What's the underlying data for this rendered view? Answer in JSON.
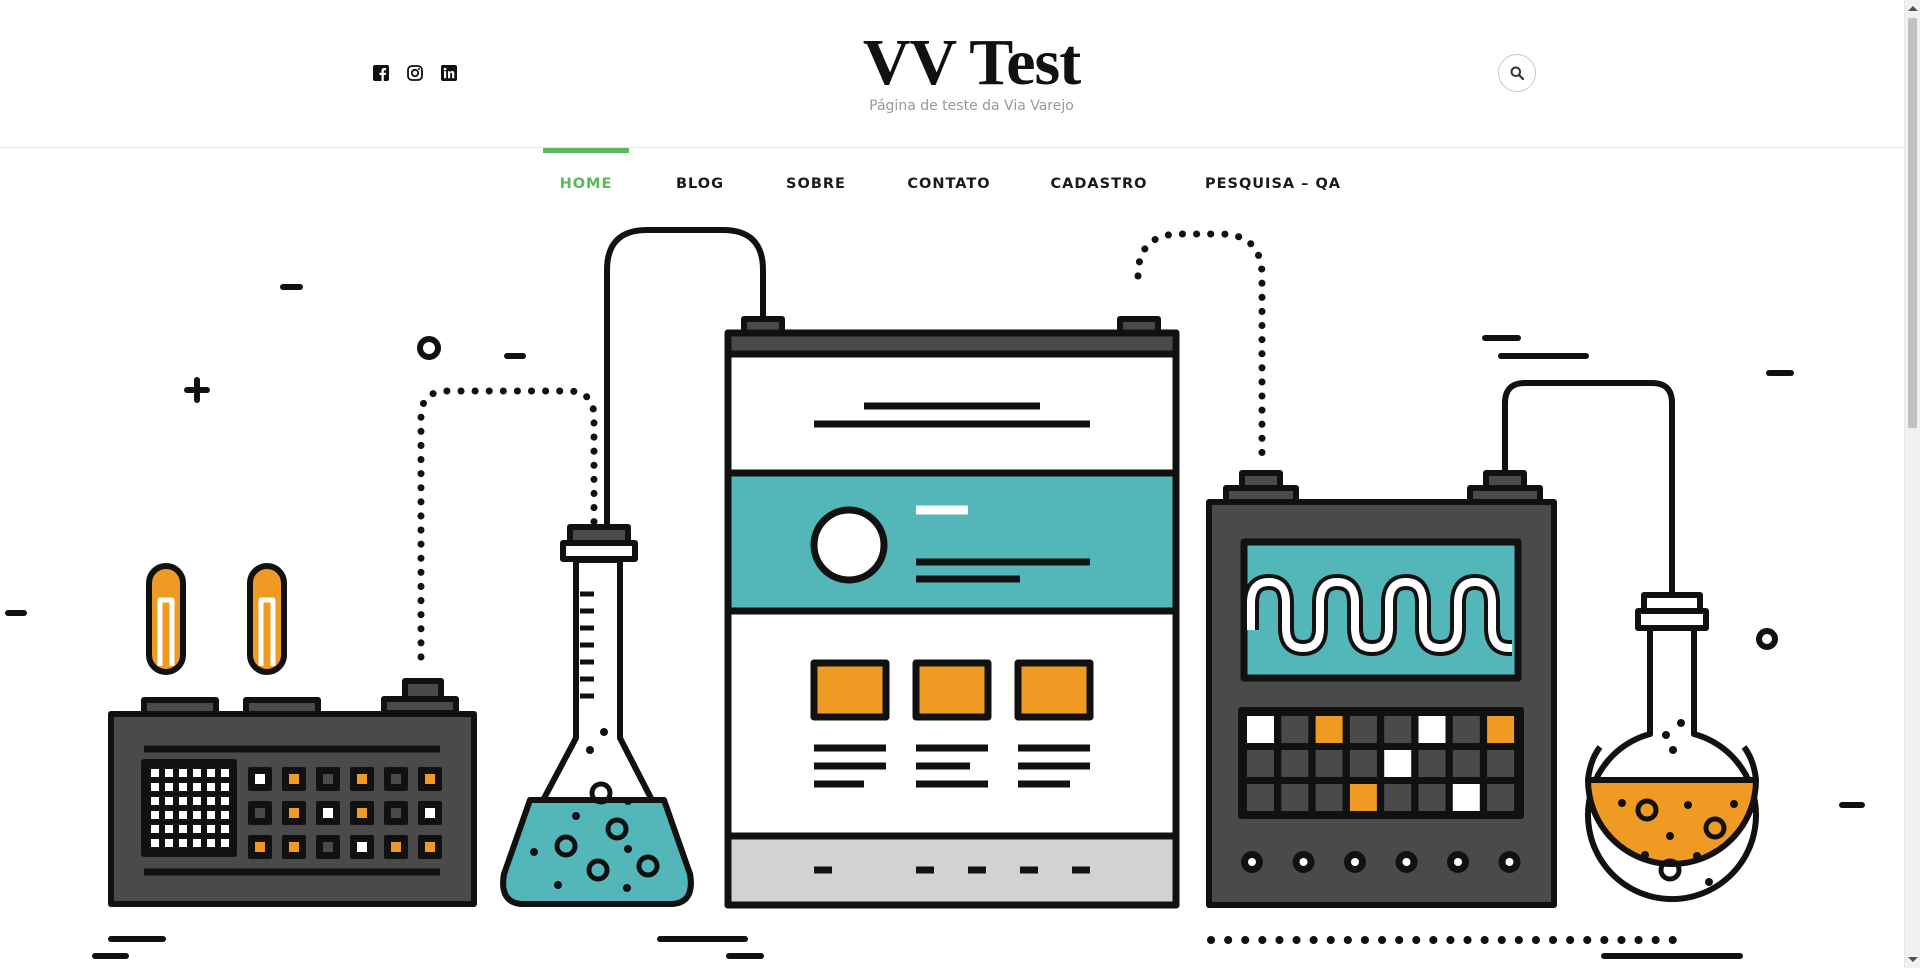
{
  "site": {
    "title": "VV Test",
    "description": "Página de teste da Via Varejo"
  },
  "social": [
    {
      "icon": "facebook-icon"
    },
    {
      "icon": "instagram-icon"
    },
    {
      "icon": "linkedin-icon"
    }
  ],
  "search": {
    "icon": "search-icon"
  },
  "nav": {
    "items": [
      {
        "label": "HOME",
        "active": true
      },
      {
        "label": "BLOG"
      },
      {
        "label": "SOBRE"
      },
      {
        "label": "CONTATO"
      },
      {
        "label": "CADASTRO"
      },
      {
        "label": "PESQUISA – QA"
      }
    ]
  },
  "hero": {
    "illustration": "laboratory-equipment-illustration"
  },
  "colors": {
    "accent": "#5cb85c",
    "teal": "#53b6b9",
    "orange": "#ef9a23",
    "dark": "#4a4a4a",
    "ink": "#111111"
  }
}
